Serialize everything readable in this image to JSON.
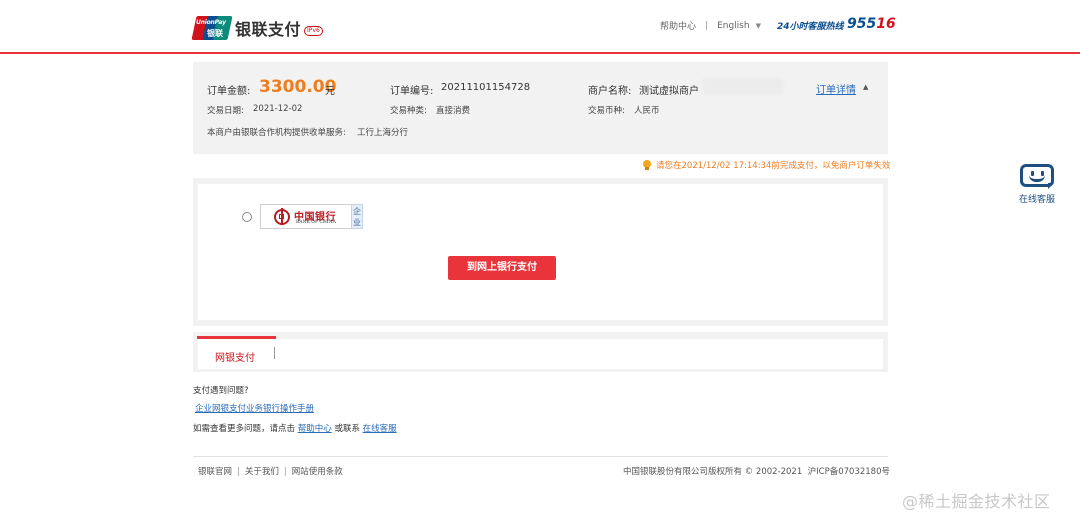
{
  "header": {
    "logo_en": "UnionPay",
    "logo_cn_mark": "银联",
    "logo_text": "银联支付",
    "logo_badge": "IPv6",
    "help_center": "帮助中心",
    "language": "English",
    "hotline_label": "24小时客服热线",
    "hotline_number_part1": "955",
    "hotline_number_part2": "16"
  },
  "order": {
    "amount_label": "订单金额:",
    "amount_value": "3300.00",
    "amount_unit": "元",
    "order_no_label": "订单编号:",
    "order_no_value": "20211101154728",
    "merchant_label": "商户名称:",
    "merchant_value": "测试虚拟商户",
    "detail_link": "订单详情",
    "date_label": "交易日期:",
    "date_value": "2021-12-02",
    "type_label": "交易种类:",
    "type_value": "直接消费",
    "currency_label": "交易币种:",
    "currency_value": "人民币",
    "acquirer_text": "本商户由银联合作机构提供收单服务:",
    "acquirer_value": "工行上海分行"
  },
  "warning": {
    "text": "请您在2021/12/02 17:14:34前完成支付，以免商户订单失效"
  },
  "payment": {
    "bank_name_cn": "中国银行",
    "bank_name_en": "BANK OF CHINA",
    "corp_tag": "企业",
    "pay_button": "到网上银行支付"
  },
  "tabs": {
    "active": "网银支付"
  },
  "help": {
    "question": "支付遇到问题?",
    "manual_link": "企业网银支付业务银行操作手册",
    "more_prefix": "如需查看更多问题，请点击",
    "help_center_link": "帮助中心",
    "more_middle": "或联系",
    "online_service_link": "在线客服"
  },
  "footer": {
    "official_site": "银联官网",
    "about_us": "关于我们",
    "terms": "网站使用条款",
    "copyright": "中国银联股份有限公司版权所有 © 2002-2021",
    "icp": "沪ICP备07032180号"
  },
  "service_widget": {
    "label": "在线客服",
    "icon": "chat-smile-icon"
  },
  "watermark": "@稀土掘金技术社区",
  "colors": {
    "brand_red": "#e8343a",
    "amount_orange": "#ee7d1f",
    "link_blue": "#2a6cb8",
    "unionpay_blue": "#0a4e92"
  }
}
